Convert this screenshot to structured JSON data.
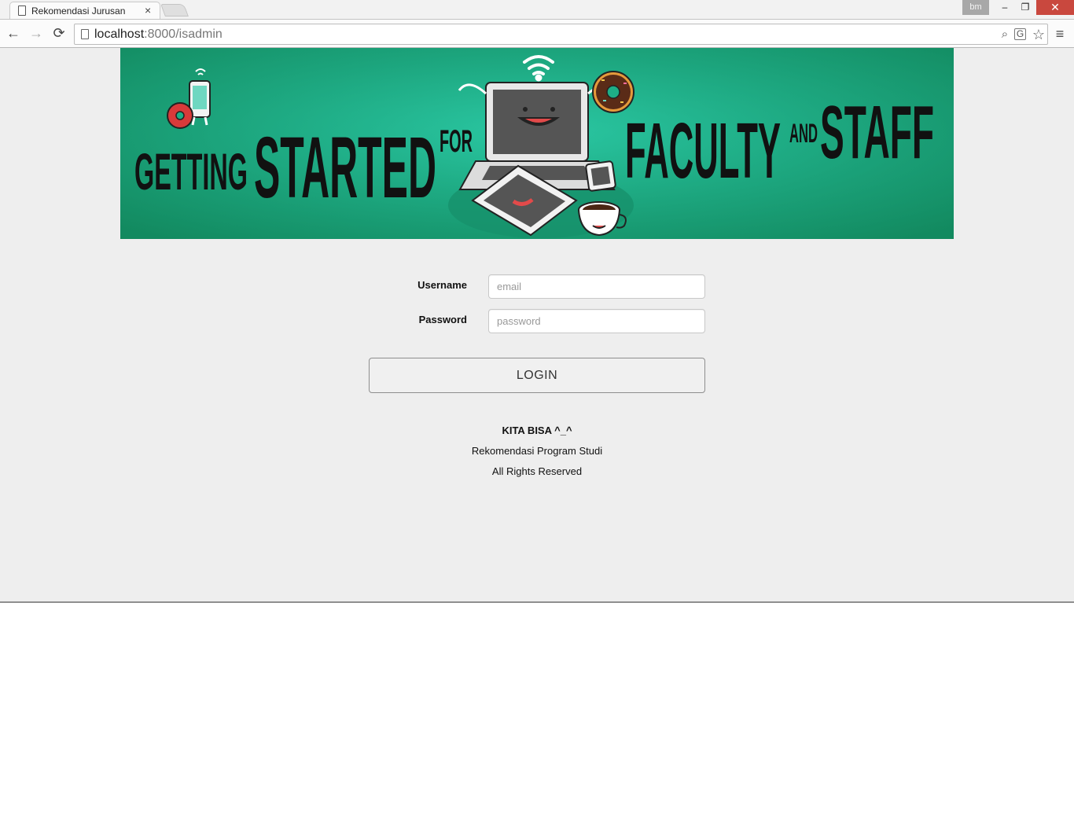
{
  "browser": {
    "tab_title": "Rekomendasi Jurusan",
    "tab_close": "×",
    "profile": "bm",
    "window_buttons": {
      "minimize": "–",
      "maximize": "❐",
      "close": "✕"
    },
    "url_host": "localhost",
    "url_rest": ":8000/isadmin",
    "nav": {
      "back": "←",
      "forward": "→",
      "reload": "⟳"
    },
    "icons": {
      "zoom": "⌕",
      "translate": "G",
      "star": "☆",
      "menu": "≡"
    }
  },
  "banner": {
    "text_getting": "GETTING",
    "text_started": "STARTED",
    "text_for": "FOR",
    "text_faculty": "FACULTY",
    "text_and": "AND",
    "text_staff": "STAFF",
    "colors": {
      "background": "#1eae86",
      "lettering": "#111111"
    }
  },
  "form": {
    "username_label": "Username",
    "username_placeholder": "email",
    "password_label": "Password",
    "password_placeholder": "password",
    "login_label": "LOGIN"
  },
  "footer": {
    "title": "KITA BISA ^_^",
    "line1": "Rekomendasi Program Studi",
    "line2": "All Rights Reserved"
  },
  "colors": {
    "page_bg": "#eeeeee",
    "close_button": "#c9483e"
  }
}
